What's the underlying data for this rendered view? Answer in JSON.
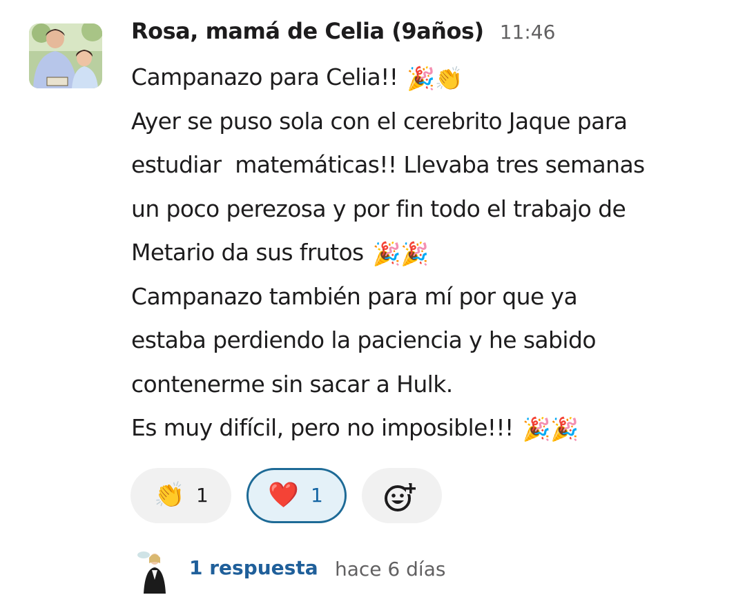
{
  "message": {
    "author": "Rosa, mamá de Celia (9años)",
    "time": "11:46",
    "lines": [
      "Campanazo para Celia!!",
      "Ayer se puso sola con el cerebrito Jaque para",
      "estudiar  matemáticas!! Llevaba tres semanas",
      "un poco perezosa y por fin todo el trabajo de",
      "Metario da sus frutos",
      "Campanazo también para mí por que ya",
      "estaba perdiendo la paciencia y he sabido",
      "contenerme sin sacar a Hulk.",
      "Es muy difícil, pero no imposible!!!"
    ],
    "inline_emoji": {
      "line0": "🎉👏",
      "line4": "🎉🎉",
      "line8": "🎉🎉"
    }
  },
  "reactions": [
    {
      "emoji": "👏",
      "count": "1",
      "active": false
    },
    {
      "emoji": "❤️",
      "count": "1",
      "active": true
    }
  ],
  "add_reaction_icon": "add-emoji-icon",
  "thread": {
    "reply_count": "1 respuesta",
    "last_reply": "hace 6 días"
  },
  "colors": {
    "link": "#1f5f9a",
    "active_reaction_border": "#1d6a96",
    "active_reaction_bg": "#e4f1f8",
    "pill_bg": "#f1f1f1",
    "muted": "#616061"
  }
}
